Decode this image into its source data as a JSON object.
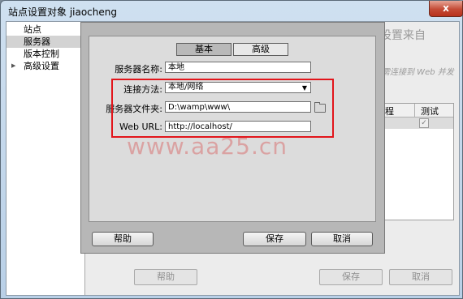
{
  "window": {
    "title": "站点设置对象 jiaocheng",
    "close_label": "x"
  },
  "sidebar": {
    "items": [
      {
        "label": "站点",
        "selected": false
      },
      {
        "label": "服务器",
        "selected": true
      },
      {
        "label": "版本控制",
        "selected": false
      },
      {
        "label": "高级设置",
        "selected": false,
        "expandable": true
      }
    ]
  },
  "background": {
    "heading": "设置来自",
    "hint": "需连接到 Web 并发",
    "table_headers": [
      "程",
      "测试"
    ],
    "buttons": {
      "help": "帮助",
      "save": "保存",
      "cancel": "取消"
    }
  },
  "dialog": {
    "tabs": [
      {
        "label": "基本",
        "active": true
      },
      {
        "label": "高级",
        "active": false
      }
    ],
    "fields": {
      "server_name": {
        "label": "服务器名称:",
        "value": "本地"
      },
      "connection": {
        "label": "连接方法:",
        "value": "本地/网络"
      },
      "server_folder": {
        "label": "服务器文件夹:",
        "value": "D:\\wamp\\www\\"
      },
      "web_url": {
        "label": "Web URL:",
        "value": "http://localhost/"
      }
    },
    "buttons": {
      "help": "帮助",
      "save": "保存",
      "cancel": "取消"
    }
  },
  "watermark": "www.aa25.cn",
  "colors": {
    "highlight_box": "#e2151b",
    "watermark": "#d65a5a"
  }
}
